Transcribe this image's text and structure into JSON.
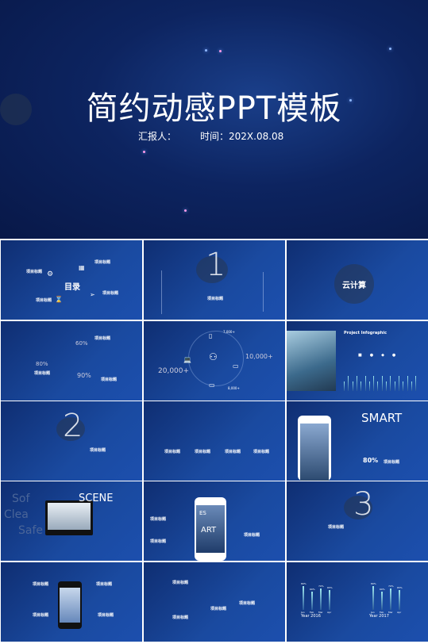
{
  "hero": {
    "title": "简约动感PPT模板",
    "reporter": "汇报人：",
    "time": "时间：202X.08.08"
  },
  "slides": {
    "toc": {
      "title": "目录",
      "items": [
        "项目标题",
        "项目标题",
        "项目标题",
        "项目标题"
      ]
    },
    "s1": {
      "number": "1",
      "title": "项目标题"
    },
    "cloud": {
      "title": "云计算"
    },
    "pct": {
      "values": [
        "60%",
        "80%",
        "90%"
      ],
      "labels": [
        "项目标题",
        "项目标题",
        "项目标题"
      ]
    },
    "stats": {
      "values": [
        "7,000+",
        "10,000+",
        "20,000+",
        "8,000+"
      ]
    },
    "info": {
      "title": "Project Infographic"
    },
    "s2": {
      "number": "2",
      "title": "项目标题"
    },
    "four": {
      "items": [
        "项目标题",
        "项目标题",
        "项目标题",
        "项目标题"
      ]
    },
    "smart": {
      "title": "SMART",
      "value": "80%",
      "label": "项目标题"
    },
    "scene": {
      "title": "SCENE",
      "words": [
        "Sof",
        "Clea",
        "Safe"
      ]
    },
    "art": {
      "words": [
        "ES",
        "ART"
      ],
      "labels": [
        "项目标题",
        "项目标题",
        "项目标题"
      ]
    },
    "s3": {
      "number": "3",
      "title": "项目标题"
    },
    "phone": {
      "labels": [
        "项目标题",
        "项目标题",
        "项目标题",
        "项目标题"
      ]
    },
    "timeline": {
      "labels": [
        "项目标题",
        "项目标题",
        "项目标题",
        "项目标题"
      ]
    },
    "bars": {
      "groups": [
        {
          "year": "Year 2016",
          "months": [
            "Jan",
            "Feb",
            "Mar",
            "Apr"
          ],
          "values": [
            80,
            60,
            70,
            65
          ]
        },
        {
          "year": "Year 2017",
          "months": [
            "Jan",
            "Feb",
            "Mar",
            "Apr"
          ],
          "values": [
            80,
            60,
            70,
            65
          ]
        }
      ]
    }
  },
  "colors": {
    "bg": "#0f2e72",
    "accent": "#9fe8ee"
  }
}
